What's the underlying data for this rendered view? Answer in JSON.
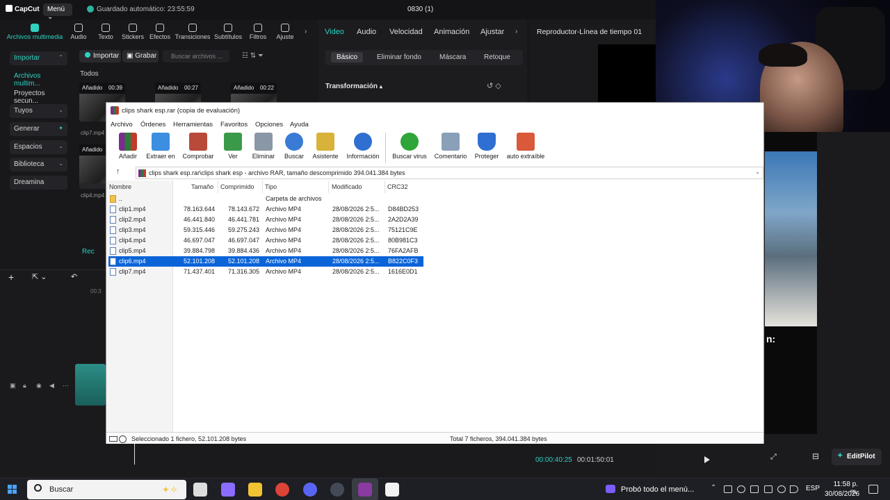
{
  "capcut": {
    "logo": "CapCut",
    "menu_label": "Menú",
    "autosave": "Guardado automático: 23:55:59",
    "project_name": "0830 (1)",
    "toolbar": [
      {
        "label": "Archivos multimedia",
        "icon": "media-icon"
      },
      {
        "label": "Audio",
        "icon": "audio-icon"
      },
      {
        "label": "Texto",
        "icon": "text-icon"
      },
      {
        "label": "Stickers",
        "icon": "sticker-icon"
      },
      {
        "label": "Efectos",
        "icon": "effects-icon"
      },
      {
        "label": "Transiciones",
        "icon": "transitions-icon"
      },
      {
        "label": "Subtítulos",
        "icon": "subtitles-icon"
      },
      {
        "label": "Filtros",
        "icon": "filters-icon"
      },
      {
        "label": "Ajuste",
        "icon": "adjust-icon"
      }
    ],
    "sidebar": [
      {
        "label": "Importar"
      },
      {
        "label": "Archivos multim..."
      },
      {
        "label": "Proyectos secun..."
      },
      {
        "label": "Tuyos"
      },
      {
        "label": "Generar"
      },
      {
        "label": "Espacios"
      },
      {
        "label": "Biblioteca"
      },
      {
        "label": "Dreamina"
      }
    ],
    "media": {
      "import_button": "Importar",
      "record_button": "Grabar",
      "search_placeholder": "Buscar archivos ...",
      "section_label": "Todos",
      "clips": [
        {
          "tag": "Añadido",
          "duration": "00:39"
        },
        {
          "tag": "Añadido",
          "duration": "00:27"
        },
        {
          "tag": "Añadido",
          "duration": "00:22"
        },
        {
          "tag": "Añadido",
          "duration": ""
        }
      ],
      "side_filenames": [
        "clip7.mp4",
        "clip4.mp4"
      ],
      "recent_fragment": "Rec"
    },
    "props": {
      "tabs": [
        "Video",
        "Audio",
        "Velocidad",
        "Animación",
        "Ajustar"
      ],
      "subtabs": [
        "Básico",
        "Eliminar fondo",
        "Máscara",
        "Retoque"
      ],
      "section": "Transformación"
    },
    "player": {
      "title": "Reproductor-Línea de tiempo 01",
      "timecode": "00:00:40:25",
      "total": "00:01:50:01",
      "overlay_text": "n:"
    },
    "timeline": {
      "ruler_fragment": "00:3"
    },
    "editpilot": "EditPilot"
  },
  "winrar": {
    "title": "clips shark esp.rar (copia de evaluación)",
    "menu": [
      "Archivo",
      "Órdenes",
      "Herramientas",
      "Favoritos",
      "Opciones",
      "Ayuda"
    ],
    "toolbar": [
      {
        "label": "Añadir",
        "icon": "add-icon",
        "color": "#c8483a"
      },
      {
        "label": "Extraer en",
        "icon": "extract-icon",
        "color": "#3b8ee0"
      },
      {
        "label": "Comprobar",
        "icon": "test-icon",
        "color": "#b94a3a"
      },
      {
        "label": "Ver",
        "icon": "view-icon",
        "color": "#3a9a4a"
      },
      {
        "label": "Eliminar",
        "icon": "delete-icon",
        "color": "#8a97a6"
      },
      {
        "label": "Buscar",
        "icon": "find-icon",
        "color": "#3a7bd5"
      },
      {
        "label": "Asistente",
        "icon": "wizard-icon",
        "color": "#d9b23a"
      },
      {
        "label": "Información",
        "icon": "info-icon",
        "color": "#2f6fd1"
      },
      {
        "label": "Buscar virus",
        "icon": "virus-scan-icon",
        "color": "#2fa53a"
      },
      {
        "label": "Comentario",
        "icon": "comment-icon",
        "color": "#8aa0b8"
      },
      {
        "label": "Proteger",
        "icon": "protect-icon",
        "color": "#2f6fd1"
      },
      {
        "label": "auto extraíble",
        "icon": "sfx-icon",
        "color": "#d9593a"
      }
    ],
    "path": "clips shark esp.rar\\clips shark esp - archivo RAR, tamaño descomprimido 394.041.384 bytes",
    "columns": [
      "Nombre",
      "Tamaño",
      "Comprimido",
      "Tipo",
      "Modificado",
      "CRC32"
    ],
    "rows": [
      {
        "name": "..",
        "size": "",
        "packed": "",
        "type": "Carpeta de archivos",
        "modified": "",
        "crc": "",
        "folder": true
      },
      {
        "name": "clip1.mp4",
        "size": "78.163.644",
        "packed": "78.143.672",
        "type": "Archivo MP4",
        "modified": "28/08/2026 2:5...",
        "crc": "D84BD253"
      },
      {
        "name": "clip2.mp4",
        "size": "46.441.840",
        "packed": "46.441.781",
        "type": "Archivo MP4",
        "modified": "28/08/2026 2:5...",
        "crc": "2A2D2A39"
      },
      {
        "name": "clip3.mp4",
        "size": "59.315.446",
        "packed": "59.275.243",
        "type": "Archivo MP4",
        "modified": "28/08/2026 2:5...",
        "crc": "75121C9E"
      },
      {
        "name": "clip4.mp4",
        "size": "46.697.047",
        "packed": "46.697.047",
        "type": "Archivo MP4",
        "modified": "28/08/2026 2:5...",
        "crc": "80B981C3"
      },
      {
        "name": "clip5.mp4",
        "size": "39.884.798",
        "packed": "39.884.436",
        "type": "Archivo MP4",
        "modified": "28/08/2026 2:5...",
        "crc": "76FA2AFB"
      },
      {
        "name": "clip6.mp4",
        "size": "52.101.208",
        "packed": "52.101.208",
        "type": "Archivo MP4",
        "modified": "28/08/2026 2:5...",
        "crc": "B822C0F3",
        "selected": true
      },
      {
        "name": "clip7.mp4",
        "size": "71.437.401",
        "packed": "71.316.305",
        "type": "Archivo MP4",
        "modified": "28/08/2026 2:5...",
        "crc": "1616E0D1"
      }
    ],
    "status_left": "Seleccionado 1 fichero, 52.101.208 bytes",
    "status_right": "Total 7 ficheros, 394.041.384 bytes"
  },
  "taskbar": {
    "search_label": "Buscar",
    "notification": "Probó todo el menú...",
    "language": "ESP",
    "time": "11:58 p. m.",
    "date": "30/08/2026",
    "apps": [
      {
        "icon": "task-view-icon",
        "color": "#dddddd"
      },
      {
        "icon": "copilot-icon",
        "color": "#8a6cff"
      },
      {
        "icon": "file-explorer-icon",
        "color": "#f1c232"
      },
      {
        "icon": "chrome-icon",
        "color": "#db4437"
      },
      {
        "icon": "discord-icon",
        "color": "#5865f2"
      },
      {
        "icon": "obs-icon",
        "color": "#444a55"
      },
      {
        "icon": "winrar-icon",
        "color": "#8a3aa0"
      },
      {
        "icon": "capcut-icon",
        "color": "#f2f2f2"
      }
    ]
  }
}
